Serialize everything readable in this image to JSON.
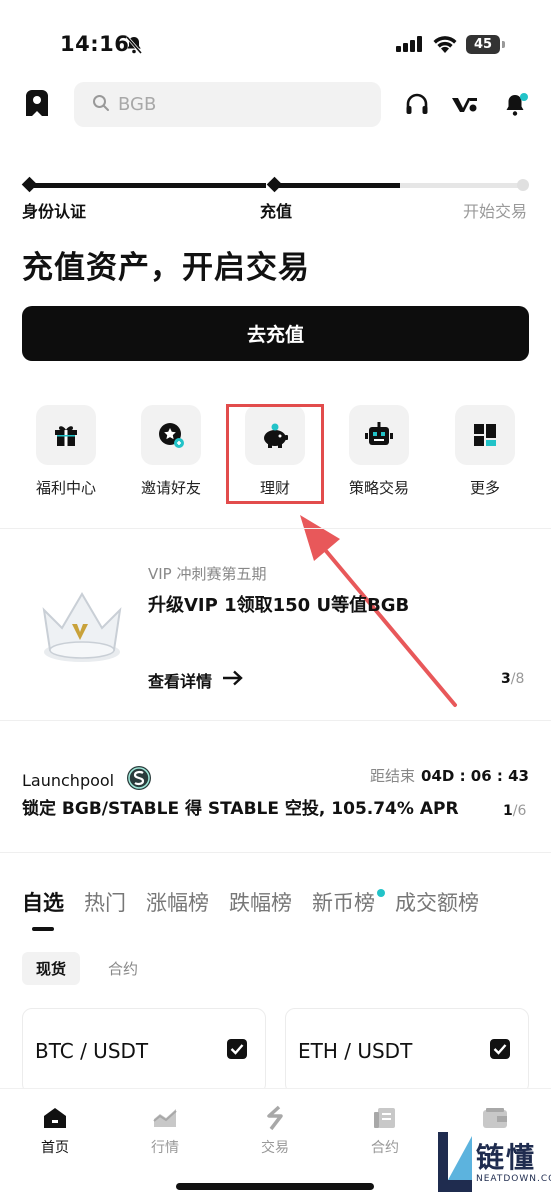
{
  "status_bar": {
    "time": "14:16",
    "battery": "45"
  },
  "header": {
    "search_placeholder": "BGB"
  },
  "progress": {
    "steps": [
      {
        "label": "身份认证",
        "state": "done"
      },
      {
        "label": "充值",
        "state": "current"
      },
      {
        "label": "开始交易",
        "state": "pending"
      }
    ]
  },
  "headline": "充值资产，开启交易",
  "cta_label": "去充值",
  "shortcuts": [
    {
      "label": "福利中心",
      "icon": "gift-icon"
    },
    {
      "label": "邀请好友",
      "icon": "invite-friend-icon"
    },
    {
      "label": "理财",
      "icon": "piggy-bank-icon"
    },
    {
      "label": "策略交易",
      "icon": "robot-icon"
    },
    {
      "label": "更多",
      "icon": "grid-more-icon"
    }
  ],
  "banner": {
    "subtitle": "VIP 冲刺赛第五期",
    "title": "升级VIP 1领取150 U等值BGB",
    "link": "查看详情",
    "page_current": "3",
    "page_total": "/8"
  },
  "launchpool": {
    "title": "Launchpool",
    "timer_label": "距结束",
    "timer_value": "04D : 06 : 43",
    "description": "锁定 BGB/STABLE 得 STABLE 空投, 105.74% APR",
    "page_current": "1",
    "page_total": "/6"
  },
  "market_tabs": [
    "自选",
    "热门",
    "涨幅榜",
    "跌幅榜",
    "新币榜",
    "成交额榜"
  ],
  "sub_tabs": [
    "现货",
    "合约"
  ],
  "pairs": [
    "BTC / USDT",
    "ETH / USDT"
  ],
  "bottom_nav": [
    "首页",
    "行情",
    "交易",
    "合约",
    "资产"
  ],
  "watermark": {
    "text": "链懂",
    "sub": "NEATDOWN.COM"
  },
  "colors": {
    "accent": "#22c3c8",
    "highlight": "#e24c4c",
    "arrow": "#e8585a"
  }
}
